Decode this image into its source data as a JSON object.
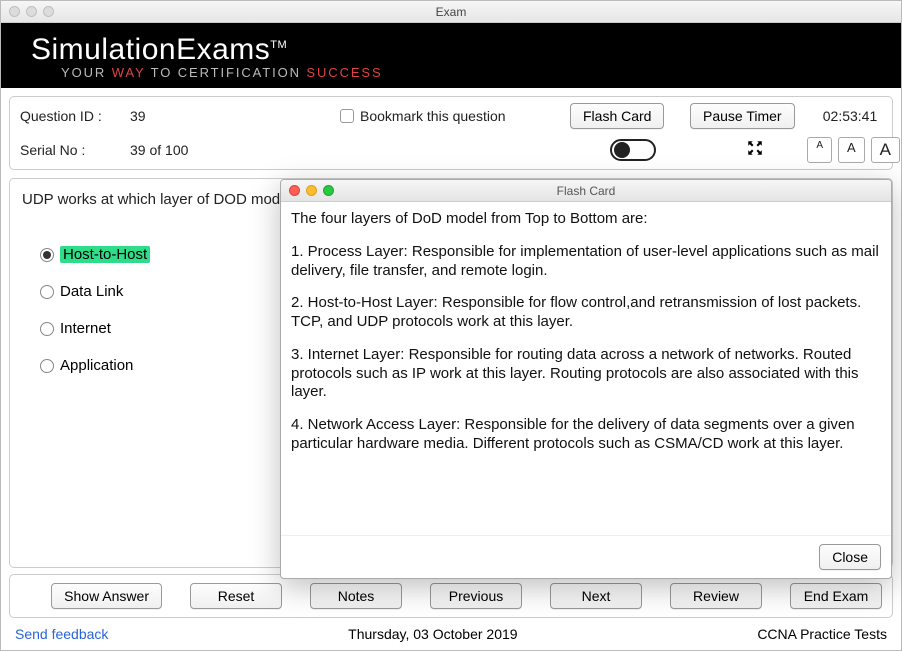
{
  "window": {
    "title": "Exam"
  },
  "brand": {
    "name": "SimulationExams",
    "tm": "TM",
    "sub_prefix": "YOUR",
    "sub_way": "WAY",
    "sub_mid": "TO CERTIFICATION",
    "sub_success": "SUCCESS"
  },
  "info": {
    "question_id_label": "Question ID :",
    "question_id": "39",
    "bookmark_label": "Bookmark this question",
    "flash_card_btn": "Flash Card",
    "pause_timer_btn": "Pause Timer",
    "timer": "02:53:41",
    "serial_label": "Serial No :",
    "serial_value": "39 of 100",
    "font_a": "A"
  },
  "question": {
    "text": "UDP works at which layer of DOD model?",
    "options": [
      {
        "label": "Host-to-Host",
        "selected": true,
        "correct": true
      },
      {
        "label": "Data Link",
        "selected": false,
        "correct": false
      },
      {
        "label": "Internet",
        "selected": false,
        "correct": false
      },
      {
        "label": "Application",
        "selected": false,
        "correct": false
      }
    ]
  },
  "bottom": {
    "show_answer": "Show Answer",
    "reset": "Reset",
    "notes": "Notes",
    "previous": "Previous",
    "next": "Next",
    "review": "Review",
    "end_exam": "End Exam"
  },
  "footer": {
    "feedback": "Send feedback",
    "date": "Thursday, 03 October 2019",
    "exam_name": "CCNA Practice Tests"
  },
  "flash": {
    "title": "Flash Card",
    "intro": "The four layers of DoD model from Top to Bottom are:",
    "p1": "1. Process Layer: Responsible for implementation of user-level applications such as mail delivery, file transfer, and remote login.",
    "p2": "2. Host-to-Host Layer: Responsible for flow control,and retransmission of lost packets. TCP, and UDP protocols work at this layer.",
    "p3": "3. Internet Layer: Responsible for routing data across a network of networks. Routed protocols such as IP work at this layer. Routing protocols are also associated with this layer.",
    "p4": "4. Network Access Layer: Responsible for the delivery of data segments over a given particular hardware media. Different protocols such as CSMA/CD work at this layer.",
    "close": "Close"
  }
}
